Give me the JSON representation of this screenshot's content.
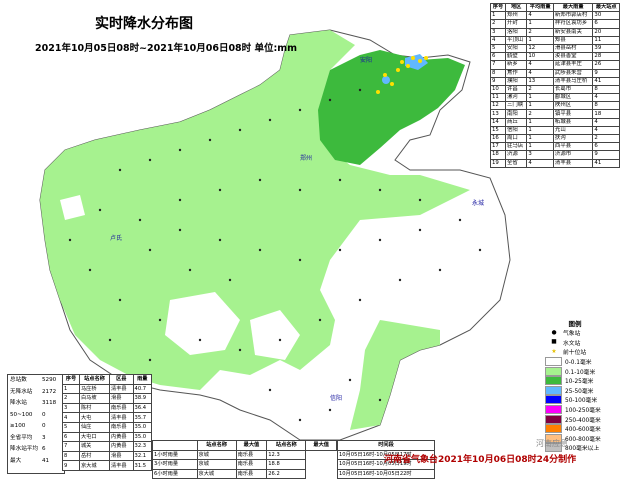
{
  "title": "实时降水分布图",
  "subtitle": "2021年10月05日08时~2021年10月06日08时 单位:mm",
  "region_table": {
    "headers": [
      "序号",
      "地区",
      "平均雨量",
      "最大雨量",
      "最大站点"
    ],
    "rows": [
      [
        "1",
        "郑州",
        "4",
        "新郑市郭店村",
        "30"
      ],
      [
        "2",
        "开封",
        "1",
        "祥符区袁坊乡",
        "6"
      ],
      [
        "3",
        "洛阳",
        "2",
        "新安县南关",
        "20"
      ],
      [
        "4",
        "平顶山",
        "1",
        "郏县",
        "11"
      ],
      [
        "5",
        "安阳",
        "12",
        "滑县岳村",
        "39"
      ],
      [
        "6",
        "鹤壁",
        "10",
        "浚县善堂",
        "28"
      ],
      [
        "7",
        "新乡",
        "4",
        "延津县丰庄",
        "26"
      ],
      [
        "8",
        "焦作",
        "4",
        "武陟县朱营",
        "9"
      ],
      [
        "9",
        "濮阳",
        "13",
        "清丰县马庄桥",
        "41"
      ],
      [
        "10",
        "许昌",
        "2",
        "长葛市",
        "8"
      ],
      [
        "11",
        "漯河",
        "1",
        "郾城区",
        "4"
      ],
      [
        "12",
        "三门峡",
        "1",
        "陕州区",
        "8"
      ],
      [
        "13",
        "南阳",
        "2",
        "镇平县",
        "18"
      ],
      [
        "14",
        "商丘",
        "1",
        "柘城县",
        "4"
      ],
      [
        "15",
        "信阳",
        "1",
        "光山",
        "4"
      ],
      [
        "16",
        "周口",
        "1",
        "扶沟",
        "2"
      ],
      [
        "17",
        "驻马店",
        "1",
        "西平县",
        "6"
      ],
      [
        "18",
        "济源",
        "3",
        "济源市",
        "9"
      ],
      [
        "19",
        "全省",
        "4",
        "清丰县",
        "41"
      ]
    ]
  },
  "stats": [
    {
      "label": "总站数",
      "value": "5290"
    },
    {
      "label": "无降水站",
      "value": "2172"
    },
    {
      "label": "降水站",
      "value": "3118"
    },
    {
      "label": "50~100",
      "value": "0"
    },
    {
      "label": "≥100",
      "value": "0"
    },
    {
      "label": "全省平均",
      "value": "3"
    },
    {
      "label": "降水站平均",
      "value": "6"
    },
    {
      "label": "最大",
      "value": "41"
    }
  ],
  "rank_table": {
    "headers": [
      "序号",
      "站点名称",
      "区县",
      "雨量"
    ],
    "rows": [
      [
        "1",
        "马庄桥",
        "清丰县",
        "40.7"
      ],
      [
        "2",
        "白马坡",
        "滑县",
        "38.9"
      ],
      [
        "3",
        "陈村",
        "南乐县",
        "36.4"
      ],
      [
        "4",
        "大屯",
        "清丰县",
        "35.7"
      ],
      [
        "5",
        "仙庄",
        "南乐县",
        "35.0"
      ],
      [
        "6",
        "大屯口",
        "内黄县",
        "35.0"
      ],
      [
        "7",
        "城关",
        "内黄县",
        "32.3"
      ],
      [
        "8",
        "岳村",
        "滑县",
        "32.1"
      ],
      [
        "9",
        "京大城",
        "清丰县",
        "31.5"
      ]
    ]
  },
  "hour_table": {
    "headers": [
      "",
      "站点名称",
      "最大值",
      "站点名称",
      "最大值"
    ],
    "rows": [
      [
        "1小时雨量",
        "京城",
        "南乐县",
        "12.3"
      ],
      [
        "3小时雨量",
        "京城",
        "南乐县",
        "18.8"
      ],
      [
        "6小时雨量",
        "京大城",
        "南乐县",
        "26.2"
      ]
    ]
  },
  "time_table": {
    "header": "时间段",
    "rows": [
      "10月05日16时-10月05日17时",
      "10月05日16时-10月05日19时",
      "10月05日16时-10月05日22时"
    ]
  },
  "legend": {
    "title": "图例",
    "symbols": [
      {
        "label": "气象站",
        "icon": "black-dot-icon"
      },
      {
        "label": "水文站",
        "icon": "black-square-icon"
      },
      {
        "label": "前十位站",
        "icon": "yellow-star-icon"
      }
    ],
    "ranges": [
      {
        "label": "0-0.1毫米",
        "color": "#ffffff"
      },
      {
        "label": "0.1-10毫米",
        "color": "#a6f28f"
      },
      {
        "label": "10-25毫米",
        "color": "#3dba3d"
      },
      {
        "label": "25-50毫米",
        "color": "#61b8ff"
      },
      {
        "label": "50-100毫米",
        "color": "#0000fe"
      },
      {
        "label": "100-250毫米",
        "color": "#fa00fa"
      },
      {
        "label": "250-400毫米",
        "color": "#800040"
      },
      {
        "label": "400-600毫米",
        "color": "#ff8000"
      },
      {
        "label": "600-800毫米",
        "color": "#ffbf80"
      },
      {
        "label": "800毫米以上",
        "color": "#c0c0c0"
      }
    ]
  },
  "map_labels": {
    "west": "卢氏",
    "center": "郑州",
    "south": "信阳",
    "east": "永城",
    "north": "安阳"
  },
  "footer": "河南省气象台2021年10月06日08时24分制作",
  "watermark": "河南应急"
}
